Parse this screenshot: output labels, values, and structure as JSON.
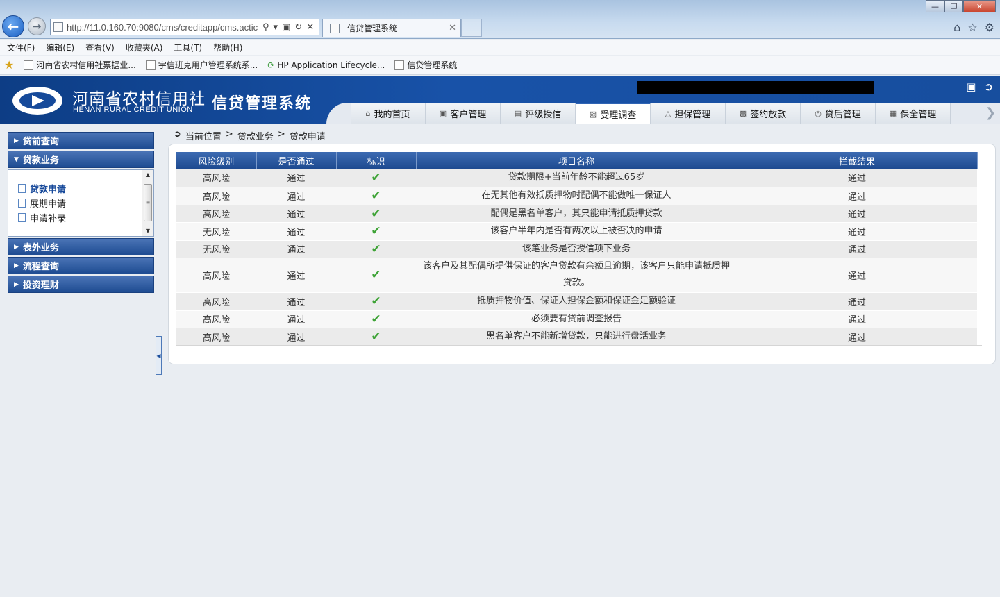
{
  "browser": {
    "url": "http://11.0.160.70:9080/cms/creditapp/cms.actic",
    "tab_title": "信贷管理系统",
    "menu": [
      "文件(F)",
      "编辑(E)",
      "查看(V)",
      "收藏夹(A)",
      "工具(T)",
      "帮助(H)"
    ],
    "favorites": [
      "河南省农村信用社票据业...",
      "宇信班克用户管理系统系...",
      "HP Application Lifecycle...",
      "信贷管理系统"
    ]
  },
  "header": {
    "logo_cn": "河南省农村信用社",
    "logo_en": "HENAN RURAL CREDIT UNION",
    "system_name": "信贷管理系统"
  },
  "nav": {
    "tabs": [
      "我的首页",
      "客户管理",
      "评级授信",
      "受理调查",
      "担保管理",
      "签约放款",
      "贷后管理",
      "保全管理"
    ],
    "active": "受理调查"
  },
  "sidebar": {
    "groups": [
      {
        "label": "贷前查询"
      },
      {
        "label": "贷款业务",
        "items": [
          "贷款申请",
          "展期申请",
          "申请补录"
        ]
      },
      {
        "label": "表外业务"
      },
      {
        "label": "流程查询"
      },
      {
        "label": "投资理财"
      }
    ]
  },
  "breadcrumb": {
    "label": "当前位置",
    "sep": ">",
    "level1": "贷款业务",
    "level2": "贷款申请"
  },
  "grid": {
    "columns": [
      "风险级别",
      "是否通过",
      "标识",
      "项目名称",
      "拦截结果"
    ],
    "rows": [
      {
        "risk": "高风险",
        "pass": "通过",
        "project": "贷款期限+当前年龄不能超过65岁",
        "result": "通过"
      },
      {
        "risk": "高风险",
        "pass": "通过",
        "project": "在无其他有效抵质押物时配偶不能做唯一保证人",
        "result": "通过"
      },
      {
        "risk": "高风险",
        "pass": "通过",
        "project": "配偶是黑名单客户，其只能申请抵质押贷款",
        "result": "通过"
      },
      {
        "risk": "无风险",
        "pass": "通过",
        "project": "该客户半年内是否有两次以上被否决的申请",
        "result": "通过"
      },
      {
        "risk": "无风险",
        "pass": "通过",
        "project": "该笔业务是否授信项下业务",
        "result": "通过"
      },
      {
        "risk": "高风险",
        "pass": "通过",
        "project": "该客户及其配偶所提供保证的客户贷款有余额且逾期，该客户只能申请抵质押贷款。",
        "result": "通过"
      },
      {
        "risk": "高风险",
        "pass": "通过",
        "project": "抵质押物价值、保证人担保金额和保证金足额验证",
        "result": "通过"
      },
      {
        "risk": "高风险",
        "pass": "通过",
        "project": "必须要有贷前调查报告",
        "result": "通过"
      },
      {
        "risk": "高风险",
        "pass": "通过",
        "project": "黑名单客户不能新增贷款，只能进行盘活业务",
        "result": "通过"
      }
    ]
  }
}
